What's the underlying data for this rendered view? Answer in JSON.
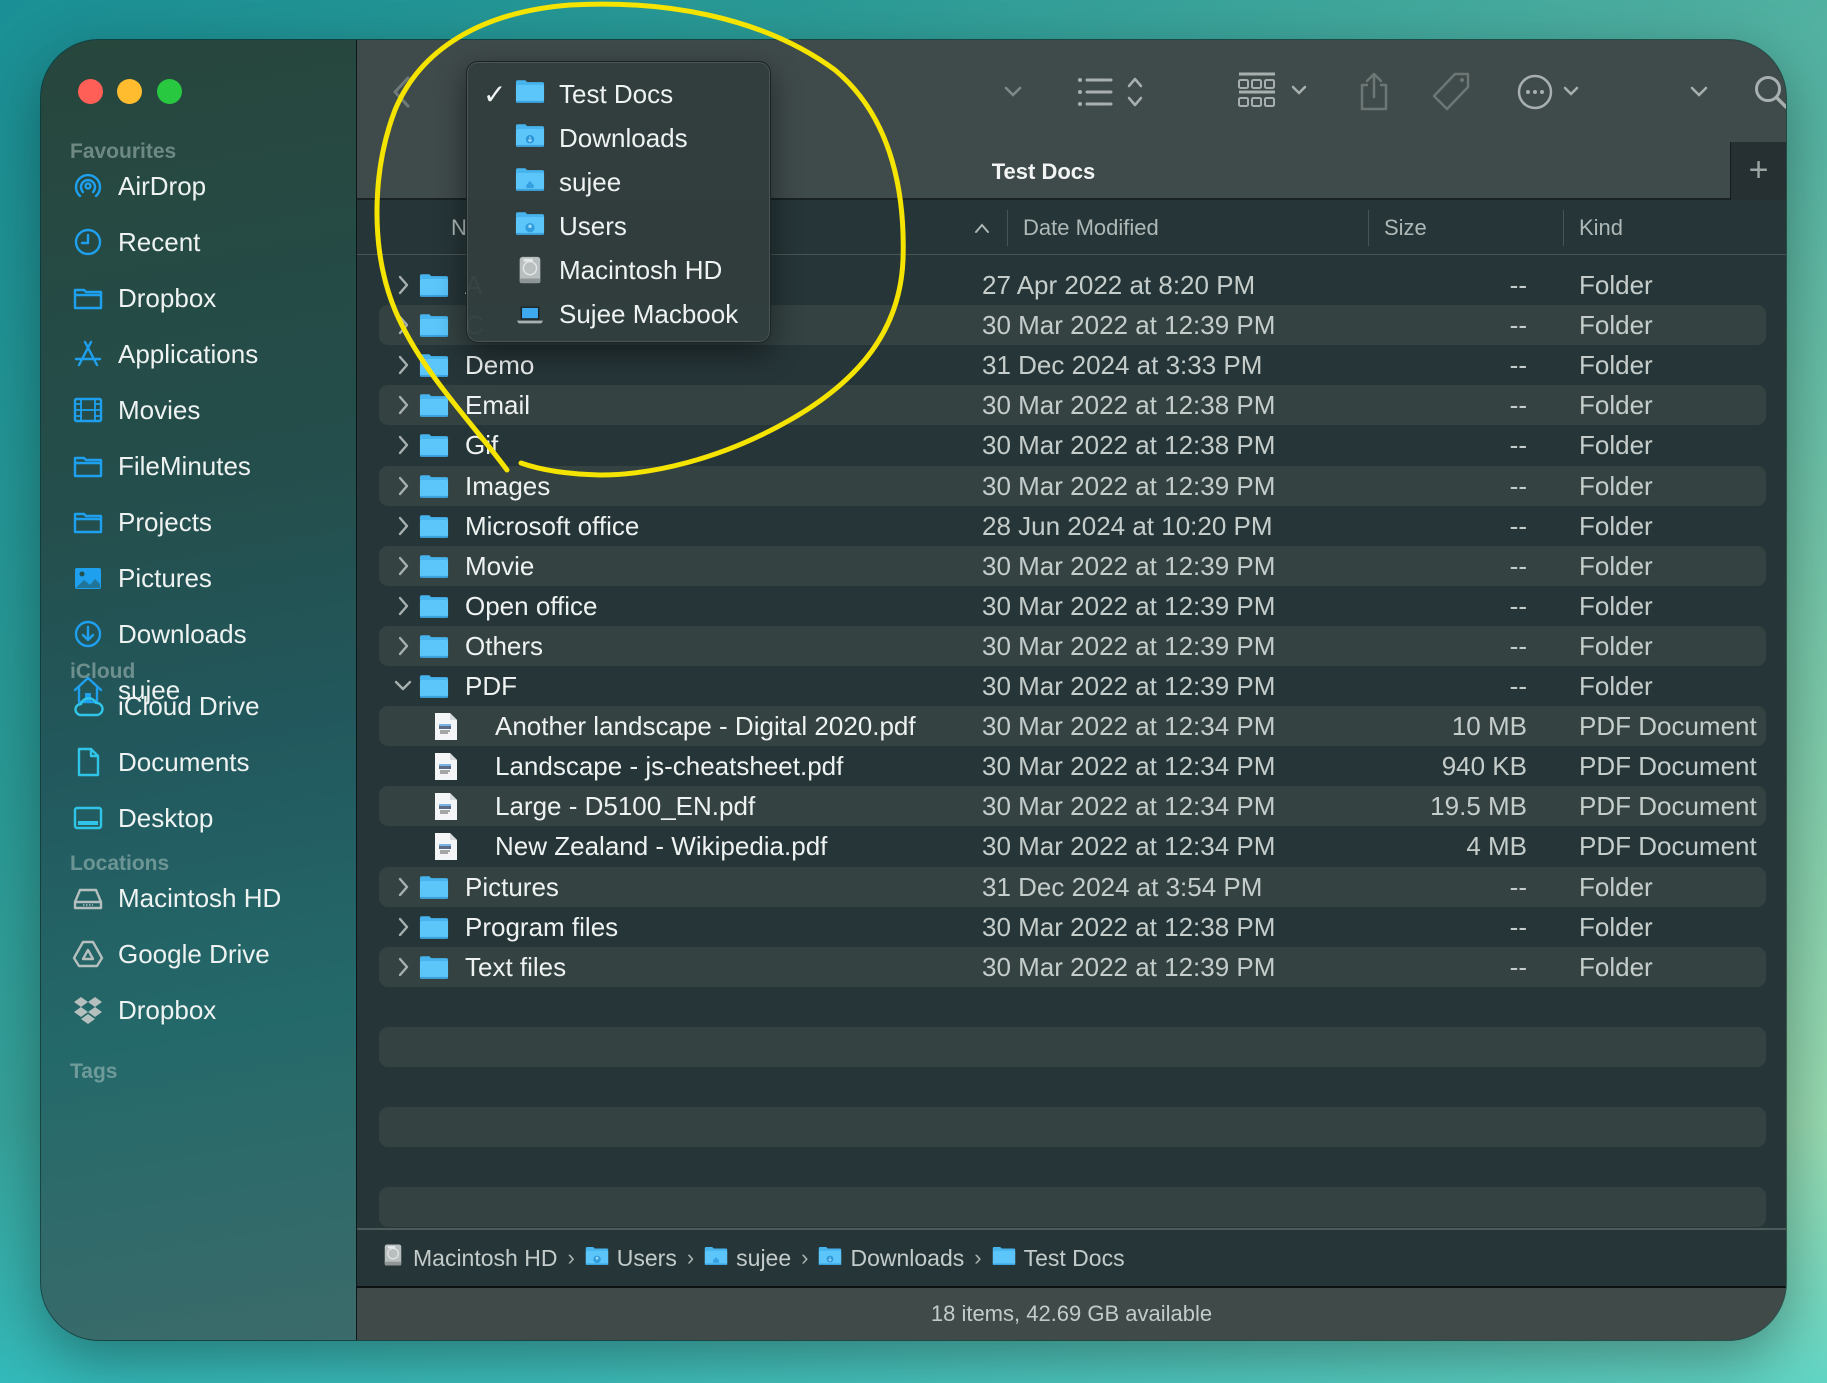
{
  "window": {
    "title": "Test Docs",
    "traffic_lights": [
      "close",
      "minimize",
      "zoom"
    ]
  },
  "sidebar": {
    "sections": [
      {
        "label": "Favourites",
        "items": [
          {
            "label": "AirDrop",
            "icon": "airdrop-icon"
          },
          {
            "label": "Recent",
            "icon": "clock-icon"
          },
          {
            "label": "Dropbox",
            "icon": "folder-icon"
          },
          {
            "label": "Applications",
            "icon": "applications-icon"
          },
          {
            "label": "Movies",
            "icon": "film-icon"
          },
          {
            "label": "FileMinutes",
            "icon": "folder-icon"
          },
          {
            "label": "Projects",
            "icon": "folder-icon"
          },
          {
            "label": "Pictures",
            "icon": "photo-icon"
          },
          {
            "label": "Downloads",
            "icon": "download-icon"
          },
          {
            "label": "sujee",
            "icon": "home-icon"
          }
        ]
      },
      {
        "label": "iCloud",
        "items": [
          {
            "label": "iCloud Drive",
            "icon": "cloud-icon"
          },
          {
            "label": "Documents",
            "icon": "document-icon"
          },
          {
            "label": "Desktop",
            "icon": "desktop-icon"
          }
        ]
      },
      {
        "label": "Locations",
        "items": [
          {
            "label": "Macintosh HD",
            "icon": "hard-drive-icon"
          },
          {
            "label": "Google Drive",
            "icon": "google-drive-icon"
          },
          {
            "label": "Dropbox",
            "icon": "dropbox-icon"
          }
        ]
      },
      {
        "label": "Tags",
        "items": []
      }
    ]
  },
  "toolbar": {
    "icons": [
      "back-icon",
      "path-dropdown-chevron-icon",
      "list-view-icon",
      "group-view-icon",
      "share-icon",
      "tag-icon",
      "more-actions-icon",
      "toolbar-overflow-chevron-icon",
      "search-icon"
    ]
  },
  "tabbar": {
    "active_tab": "Test Docs",
    "add_tab_label": "+"
  },
  "path_dropdown": {
    "items": [
      {
        "label": "Test Docs",
        "icon": "folder-icon",
        "checked": true
      },
      {
        "label": "Downloads",
        "icon": "downloads-folder-icon",
        "checked": false
      },
      {
        "label": "sujee",
        "icon": "home-folder-icon",
        "checked": false
      },
      {
        "label": "Users",
        "icon": "users-folder-icon",
        "checked": false
      },
      {
        "label": "Macintosh HD",
        "icon": "hard-drive-icon",
        "checked": false
      },
      {
        "label": "Sujee Macbook",
        "icon": "laptop-icon",
        "checked": false
      }
    ],
    "check_glyph": "✓"
  },
  "columns": {
    "name": "N",
    "date": "Date Modified",
    "size": "Size",
    "kind": "Kind",
    "sort_indicator": "^"
  },
  "files": [
    {
      "name": "A",
      "date": "27 Apr 2022 at 8:20 PM",
      "size": "--",
      "kind": "Folder",
      "type": "folder",
      "expanded": false,
      "depth": 0
    },
    {
      "name": "C",
      "date": "30 Mar 2022 at 12:39 PM",
      "size": "--",
      "kind": "Folder",
      "type": "folder",
      "expanded": false,
      "depth": 0
    },
    {
      "name": "Demo",
      "date": "31 Dec 2024 at 3:33 PM",
      "size": "--",
      "kind": "Folder",
      "type": "folder",
      "expanded": false,
      "depth": 0
    },
    {
      "name": "Email",
      "date": "30 Mar 2022 at 12:38 PM",
      "size": "--",
      "kind": "Folder",
      "type": "folder",
      "expanded": false,
      "depth": 0
    },
    {
      "name": "Gif",
      "date": "30 Mar 2022 at 12:38 PM",
      "size": "--",
      "kind": "Folder",
      "type": "folder",
      "expanded": false,
      "depth": 0
    },
    {
      "name": "Images",
      "date": "30 Mar 2022 at 12:39 PM",
      "size": "--",
      "kind": "Folder",
      "type": "folder",
      "expanded": false,
      "depth": 0
    },
    {
      "name": "Microsoft office",
      "date": "28 Jun 2024 at 10:20 PM",
      "size": "--",
      "kind": "Folder",
      "type": "folder",
      "expanded": false,
      "depth": 0
    },
    {
      "name": "Movie",
      "date": "30 Mar 2022 at 12:39 PM",
      "size": "--",
      "kind": "Folder",
      "type": "folder",
      "expanded": false,
      "depth": 0
    },
    {
      "name": "Open office",
      "date": "30 Mar 2022 at 12:39 PM",
      "size": "--",
      "kind": "Folder",
      "type": "folder",
      "expanded": false,
      "depth": 0
    },
    {
      "name": "Others",
      "date": "30 Mar 2022 at 12:39 PM",
      "size": "--",
      "kind": "Folder",
      "type": "folder",
      "expanded": false,
      "depth": 0
    },
    {
      "name": "PDF",
      "date": "30 Mar 2022 at 12:39 PM",
      "size": "--",
      "kind": "Folder",
      "type": "folder",
      "expanded": true,
      "depth": 0
    },
    {
      "name": "Another landscape - Digital 2020.pdf",
      "date": "30 Mar 2022 at 12:34 PM",
      "size": "10 MB",
      "kind": "PDF Document",
      "type": "pdf",
      "depth": 1
    },
    {
      "name": "Landscape - js-cheatsheet.pdf",
      "date": "30 Mar 2022 at 12:34 PM",
      "size": "940 KB",
      "kind": "PDF Document",
      "type": "pdf",
      "depth": 1
    },
    {
      "name": "Large - D5100_EN.pdf",
      "date": "30 Mar 2022 at 12:34 PM",
      "size": "19.5 MB",
      "kind": "PDF Document",
      "type": "pdf",
      "depth": 1
    },
    {
      "name": "New Zealand - Wikipedia.pdf",
      "date": "30 Mar 2022 at 12:34 PM",
      "size": "4 MB",
      "kind": "PDF Document",
      "type": "pdf",
      "depth": 1
    },
    {
      "name": "Pictures",
      "date": "31 Dec 2024 at 3:54 PM",
      "size": "--",
      "kind": "Folder",
      "type": "folder",
      "expanded": false,
      "depth": 0
    },
    {
      "name": "Program files",
      "date": "30 Mar 2022 at 12:38 PM",
      "size": "--",
      "kind": "Folder",
      "type": "folder",
      "expanded": false,
      "depth": 0
    },
    {
      "name": "Text files",
      "date": "30 Mar 2022 at 12:39 PM",
      "size": "--",
      "kind": "Folder",
      "type": "folder",
      "expanded": false,
      "depth": 0
    }
  ],
  "pathbar": {
    "crumbs": [
      {
        "label": "Macintosh HD",
        "icon": "hard-drive-icon"
      },
      {
        "label": "Users",
        "icon": "users-folder-icon"
      },
      {
        "label": "sujee",
        "icon": "home-folder-icon"
      },
      {
        "label": "Downloads",
        "icon": "downloads-folder-icon"
      },
      {
        "label": "Test Docs",
        "icon": "folder-icon"
      }
    ],
    "separator": "›"
  },
  "status": {
    "text": "18 items, 42.69 GB available"
  },
  "annotation": {
    "type": "hand-drawn circle",
    "color": "#f5e300",
    "target": "path_dropdown"
  },
  "colors": {
    "accent": "#1ba1f2",
    "folder_blue": "#5ac8fa",
    "sidebar_icon": "#1ea0ef"
  }
}
